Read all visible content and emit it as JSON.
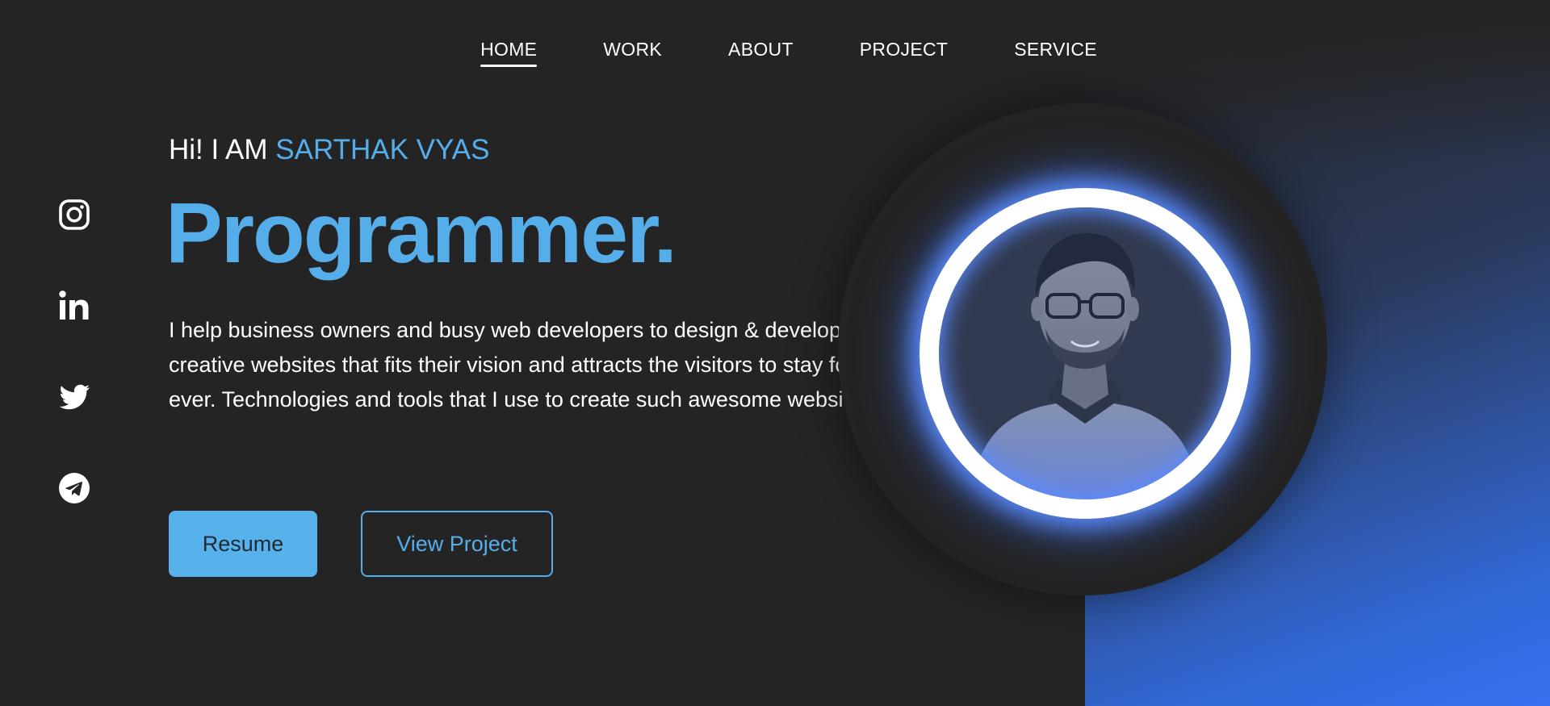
{
  "nav": {
    "items": [
      {
        "label": "HOME",
        "active": true
      },
      {
        "label": "WORK"
      },
      {
        "label": "ABOUT"
      },
      {
        "label": "PROJECT"
      },
      {
        "label": "SERVICE"
      }
    ]
  },
  "social": {
    "icons": [
      "instagram-icon",
      "linkedin-icon",
      "twitter-icon",
      "telegram-icon"
    ]
  },
  "hero": {
    "greeting_prefix": "Hi! I AM ",
    "name": "SARTHAK VYAS",
    "headline": "Programmer.",
    "bio": "I help business owners and busy web developers to design & develop creative websites that fits their vision and attracts the visitors to stay for ever. Technologies and tools that I use to create such awesome websites.",
    "buttons": {
      "resume": "Resume",
      "view_project": "View Project"
    }
  },
  "colors": {
    "background": "#242424",
    "accent": "#55aeea",
    "gradient_end": "#3670f0",
    "ring_glow": "#5a8cff"
  }
}
